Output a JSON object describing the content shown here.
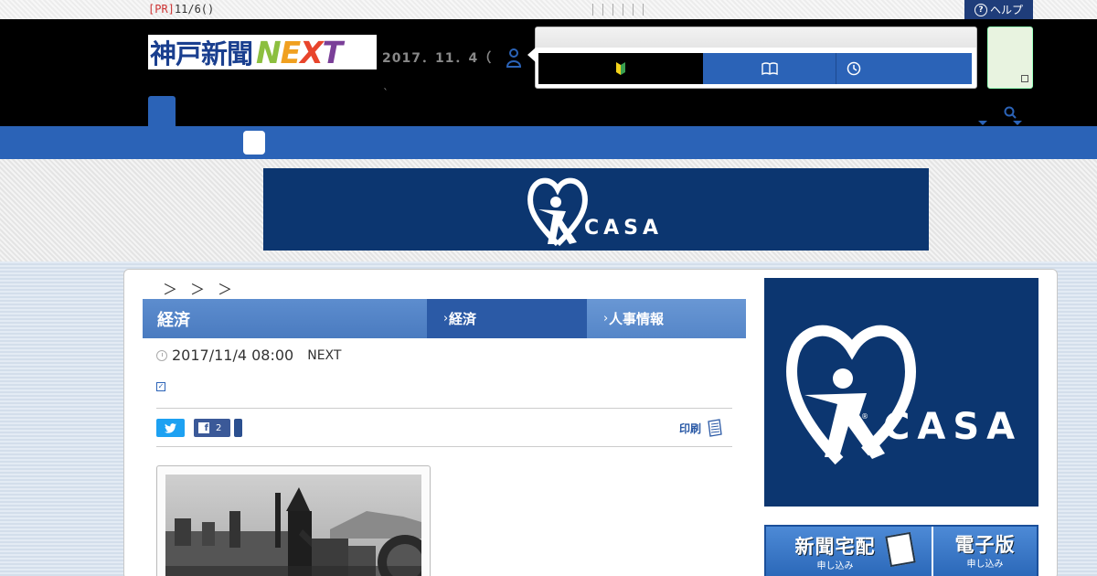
{
  "topbar": {
    "pr_tag": "[PR]",
    "pr_text": "11/6()",
    "help_label": "ヘルプ"
  },
  "header": {
    "logo_jp": "神戸新聞",
    "logo_next": [
      "N",
      "E",
      "X",
      "T"
    ],
    "date": "2017．11．4（",
    "tick": "`"
  },
  "banner": {
    "brand": "CASA"
  },
  "article": {
    "breadcrumb": "＞＞＞",
    "category_title": "経済",
    "tabs": [
      {
        "label": "経済"
      },
      {
        "label": "人事情報"
      }
    ],
    "datetime": "2017/11/4 08:00",
    "source": "NEXT",
    "checkbox_mark": "✓",
    "share": {
      "facebook_count": "2"
    },
    "print_label": "印刷"
  },
  "sidebar": {
    "ad_brand": "CASA",
    "promo": {
      "left_title": "新聞宅配",
      "left_sub": "申し込み",
      "right_title": "電子版",
      "right_sub": "申し込み"
    }
  },
  "colors": {
    "brand_blue": "#2b63b7",
    "ad_navy": "#0c3670",
    "header_black": "#000000"
  }
}
